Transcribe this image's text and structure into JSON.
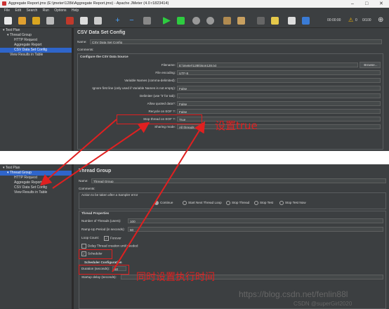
{
  "window": {
    "title": "Aggregate Report.jmx (E:\\jmeter\\128k\\Aggregate Report.jmx) - Apache JMeter (4.0 r1823414)"
  },
  "menu": [
    "File",
    "Edit",
    "Search",
    "Run",
    "Options",
    "Help"
  ],
  "toolbar": {
    "timer": "00:00:00",
    "warn_count": "0",
    "threads": "0/100"
  },
  "tree1": [
    "Test Plan",
    "Thread Group",
    "HTTP Request",
    "Aggregate Report",
    "CSV Data Set Config",
    "View Results in Table"
  ],
  "csv": {
    "title": "CSV Data Set Config",
    "name_label": "Name:",
    "name_value": "CSV Data Set Config",
    "comments_label": "Comments:",
    "section": "Configure the CSV Data Source",
    "browse": "Browse...",
    "rows": [
      {
        "label": "Filename:",
        "value": "E:\\jmeter\\128k\\json128.txt"
      },
      {
        "label": "File encoding:",
        "value": "UTF-8"
      },
      {
        "label": "Variable Names (comma-delimited):",
        "value": ""
      },
      {
        "label": "Ignore first line (only used if Variable Names is not empty):",
        "value": "False"
      },
      {
        "label": "Delimiter (use '\\t' for tab):",
        "value": ","
      },
      {
        "label": "Allow quoted data?:",
        "value": "False"
      },
      {
        "label": "Recycle on EOF ?:",
        "value": "False"
      },
      {
        "label": "Stop thread on EOF ?:",
        "value": "True"
      },
      {
        "label": "Sharing mode:",
        "value": "All threads"
      }
    ]
  },
  "tree2": [
    "Test Plan",
    "Thread Group",
    "HTTP Request",
    "Aggregate Report",
    "CSV Data Set Config",
    "View Results in Table"
  ],
  "tg": {
    "title": "Thread Group",
    "name_label": "Name:",
    "name_value": "Thread Group",
    "comments_label": "Comments:",
    "error_section": "Action to be taken after a Sampler error",
    "error_options": [
      "Continue",
      "Start Next Thread Loop",
      "Stop Thread",
      "Stop Test",
      "Stop Test Now"
    ],
    "props_section": "Thread Properties",
    "threads_label": "Number of Threads (users):",
    "threads_value": "100",
    "ramp_label": "Ramp-Up Period (in seconds):",
    "ramp_value": "60",
    "loop_label": "Loop Count:",
    "loop_forever": "Forever",
    "delay_label": "Delay Thread creation until needed",
    "scheduler_label": "Scheduler",
    "sched_section": "Scheduler Configuration",
    "duration_label": "Duration (seconds):",
    "duration_value": "60",
    "startup_label": "Startup delay (seconds):"
  },
  "annotations": {
    "top": "设置true",
    "bottom": "同时设置执行时间"
  },
  "watermark": {
    "url": "https://blog.csdn.net/fenlin88l",
    "credit": "CSDN @superGirl2020"
  },
  "colors": {
    "accent": "#2f65ca",
    "annotation": "#e02020"
  }
}
